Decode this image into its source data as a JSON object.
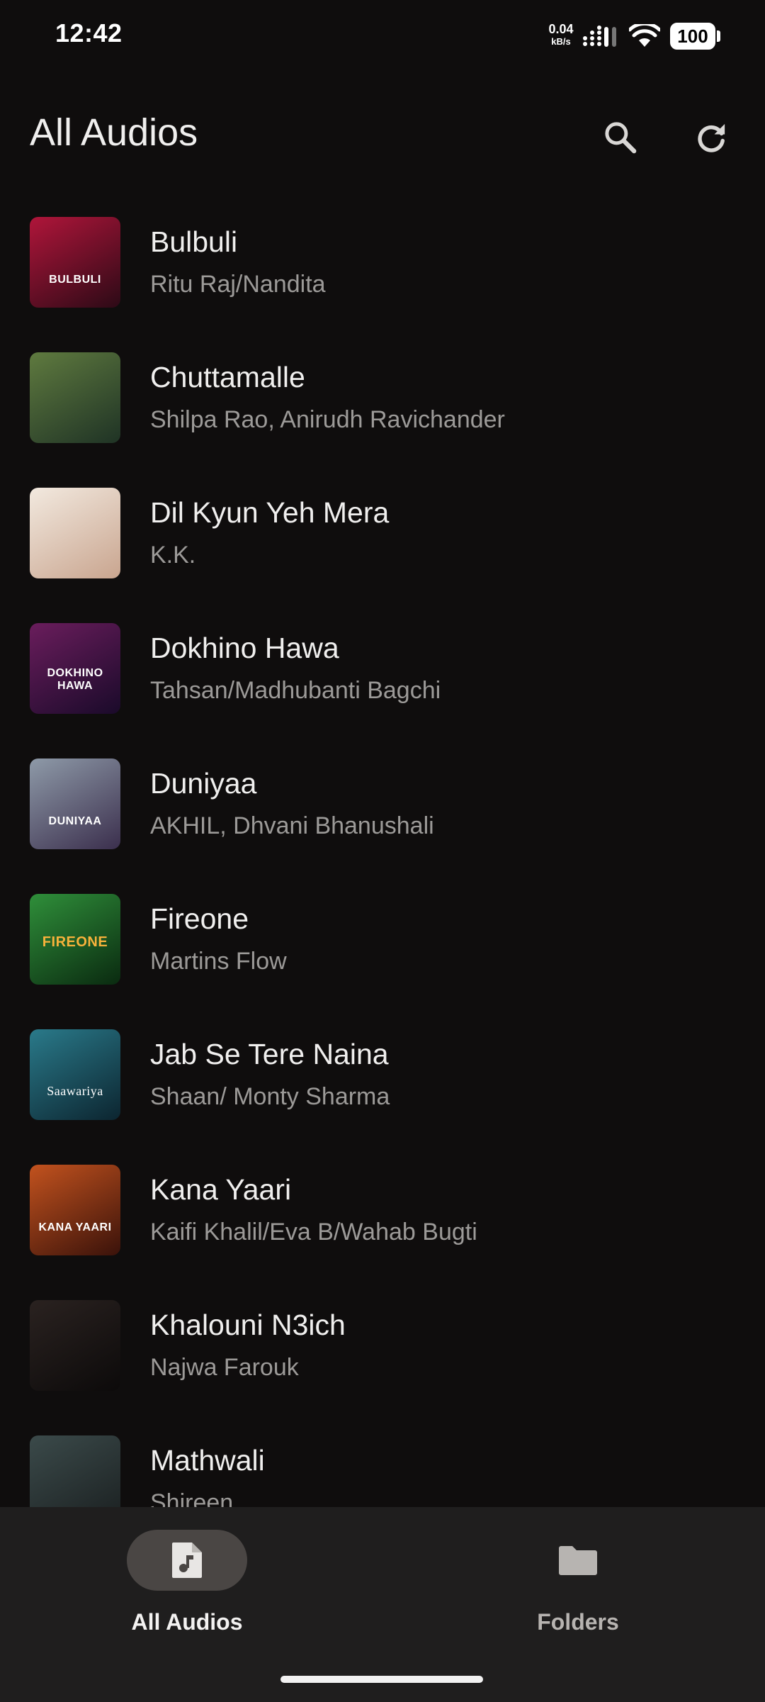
{
  "status_bar": {
    "time": "12:42",
    "net_speed_value": "0.04",
    "net_speed_unit": "kB/s",
    "battery": "100"
  },
  "header": {
    "title": "All Audios",
    "search_icon": "search-icon",
    "refresh_icon": "refresh-icon"
  },
  "songs": [
    {
      "title": "Bulbuli",
      "artist": "Ritu Raj/Nandita",
      "art_text": "BULBULI",
      "art_colors": [
        "#b0153a",
        "#2c0a16"
      ]
    },
    {
      "title": "Chuttamalle",
      "artist": "Shilpa Rao, Anirudh Ravichander",
      "art_text": "",
      "art_colors": [
        "#5f7a3f",
        "#1f3325"
      ]
    },
    {
      "title": "Dil Kyun Yeh Mera",
      "artist": "K.K.",
      "art_text": "",
      "art_colors": [
        "#f2e9df",
        "#c9a58f"
      ]
    },
    {
      "title": "Dokhino Hawa",
      "artist": "Tahsan/Madhubanti Bagchi",
      "art_text": "DOKHINO HAWA",
      "art_colors": [
        "#6a1d5c",
        "#1a0a2a"
      ]
    },
    {
      "title": "Duniyaa",
      "artist": "AKHIL, Dhvani Bhanushali",
      "art_text": "DUNIYAA",
      "art_colors": [
        "#8e9aa8",
        "#3b2f4d"
      ]
    },
    {
      "title": "Fireone",
      "artist": "Martins Flow",
      "art_text": "FIREONE",
      "art_colors": [
        "#2f8f3a",
        "#0a2a10"
      ]
    },
    {
      "title": "Jab Se Tere Naina",
      "artist": "Shaan/ Monty Sharma",
      "art_text": "Saawariya",
      "art_colors": [
        "#2a7a8a",
        "#0c2530"
      ]
    },
    {
      "title": "Kana Yaari",
      "artist": "Kaifi Khalil/Eva B/Wahab Bugti",
      "art_text": "KANA YAARI",
      "art_colors": [
        "#c2521e",
        "#3a120a"
      ]
    },
    {
      "title": "Khalouni N3ich",
      "artist": "Najwa Farouk",
      "art_text": "",
      "art_colors": [
        "#2a2220",
        "#0c0a0a"
      ]
    },
    {
      "title": "Mathwali",
      "artist": "Shireen",
      "art_text": "",
      "art_colors": [
        "#3b4a4a",
        "#1a1f20"
      ]
    }
  ],
  "bottom_nav": {
    "all_audios_label": "All Audios",
    "folders_label": "Folders",
    "all_audios_icon": "music-file-icon",
    "folders_icon": "folder-icon",
    "selected": "All Audios"
  }
}
